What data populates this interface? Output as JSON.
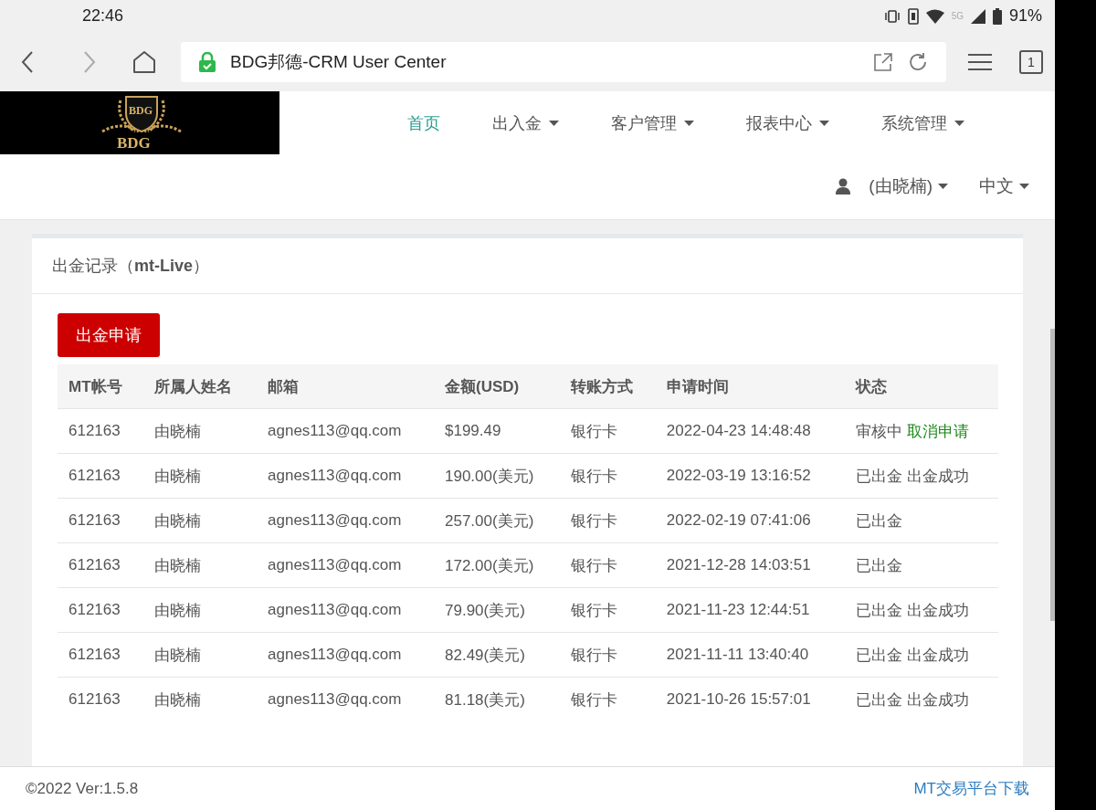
{
  "status_bar": {
    "time": "22:46",
    "network": "5G",
    "battery": "91%"
  },
  "browser": {
    "title": "BDG邦德-CRM User Center",
    "tab_count": "1"
  },
  "logo": {
    "emblem": "BDG",
    "wordmark": "BDG"
  },
  "nav": [
    {
      "label": "首页",
      "selected": true,
      "dropdown": false
    },
    {
      "label": "出入金",
      "selected": false,
      "dropdown": true
    },
    {
      "label": "客户管理",
      "selected": false,
      "dropdown": true
    },
    {
      "label": "报表中心",
      "selected": false,
      "dropdown": true
    },
    {
      "label": "系统管理",
      "selected": false,
      "dropdown": true
    }
  ],
  "user_menu": {
    "user": "(由晓楠)",
    "language": "中文"
  },
  "panel": {
    "title": "出金记录（",
    "title_bold": "mt-Live",
    "title_end": "）",
    "apply_button": "出金申请"
  },
  "table": {
    "columns": [
      "MT帐号",
      "所属人姓名",
      "邮箱",
      "金额(USD)",
      "转账方式",
      "申请时间",
      "状态"
    ],
    "rows": [
      {
        "cells": [
          "612163",
          "由晓楠",
          "agnes113@qq.com",
          "$199.49",
          "银行卡",
          "2022-04-23 14:48:48"
        ],
        "status": [
          {
            "text": "审核中",
            "kind": "plain"
          },
          {
            "text": "取消申请",
            "kind": "link"
          }
        ]
      },
      {
        "cells": [
          "612163",
          "由晓楠",
          "agnes113@qq.com",
          "190.00(美元)",
          "银行卡",
          "2022-03-19 13:16:52"
        ],
        "status": [
          {
            "text": "已出金",
            "kind": "plain"
          },
          {
            "text": "出金成功",
            "kind": "plain"
          }
        ]
      },
      {
        "cells": [
          "612163",
          "由晓楠",
          "agnes113@qq.com",
          "257.00(美元)",
          "银行卡",
          "2022-02-19 07:41:06"
        ],
        "status": [
          {
            "text": "已出金",
            "kind": "plain"
          }
        ]
      },
      {
        "cells": [
          "612163",
          "由晓楠",
          "agnes113@qq.com",
          "172.00(美元)",
          "银行卡",
          "2021-12-28 14:03:51"
        ],
        "status": [
          {
            "text": "已出金",
            "kind": "plain"
          }
        ]
      },
      {
        "cells": [
          "612163",
          "由晓楠",
          "agnes113@qq.com",
          "79.90(美元)",
          "银行卡",
          "2021-11-23 12:44:51"
        ],
        "status": [
          {
            "text": "已出金",
            "kind": "plain"
          },
          {
            "text": "出金成功",
            "kind": "plain"
          }
        ]
      },
      {
        "cells": [
          "612163",
          "由晓楠",
          "agnes113@qq.com",
          "82.49(美元)",
          "银行卡",
          "2021-11-11 13:40:40"
        ],
        "status": [
          {
            "text": "已出金",
            "kind": "plain"
          },
          {
            "text": "出金成功",
            "kind": "plain"
          }
        ]
      },
      {
        "cells": [
          "612163",
          "由晓楠",
          "agnes113@qq.com",
          "81.18(美元)",
          "银行卡",
          "2021-10-26 15:57:01"
        ],
        "status": [
          {
            "text": "已出金",
            "kind": "plain"
          },
          {
            "text": "出金成功",
            "kind": "plain"
          }
        ]
      }
    ]
  },
  "footer": {
    "version": "©2022 Ver:1.5.8",
    "download_link": "MT交易平台下载"
  }
}
